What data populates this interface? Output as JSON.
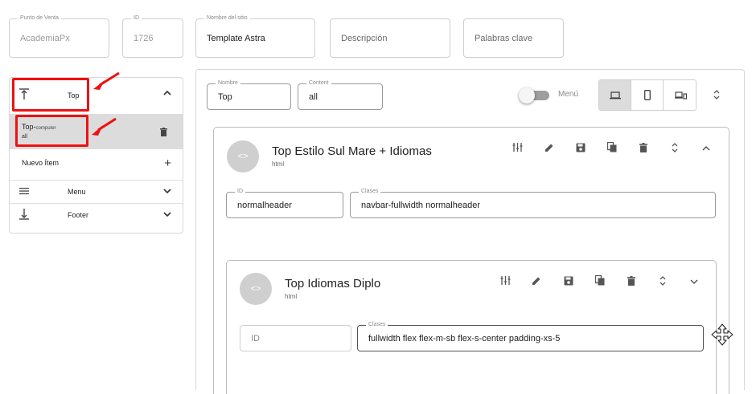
{
  "top_fields": {
    "punto_venta": {
      "label": "Punto de Venta",
      "value": "AcademiaPx"
    },
    "id": {
      "label": "ID",
      "value": "1726"
    },
    "nombre_sitio": {
      "label": "Nombre del sitio",
      "value": "Template Astra"
    },
    "descripcion": {
      "placeholder": "Descripción"
    },
    "palabras_clave": {
      "placeholder": "Palabras clave"
    }
  },
  "sidebar": {
    "top": {
      "label": "Top",
      "icon": "align-top-icon"
    },
    "top_item": {
      "title": "Top-",
      "device": "computer",
      "sub": "all"
    },
    "nuevo_item": {
      "label": "Nuevo Ítem"
    },
    "menu": {
      "label": "Menu",
      "icon": "menu-icon"
    },
    "footer": {
      "label": "Footer",
      "icon": "align-bottom-icon"
    }
  },
  "section": {
    "nombre": {
      "label": "Nombre",
      "value": "Top"
    },
    "content": {
      "label": "Content",
      "value": "all"
    },
    "menu_toggle_label": "Menú",
    "menu_toggle_on": false,
    "devices": [
      "computer",
      "phone",
      "devices"
    ],
    "active_device": "computer"
  },
  "block1": {
    "avatar": "<>",
    "title": "Top Estilo Sul Mare + Idiomas",
    "type": "html",
    "id": {
      "label": "ID",
      "value": "normalheader"
    },
    "clases": {
      "label": "Clases",
      "value": "navbar-fullwidth normalheader"
    }
  },
  "block2": {
    "avatar": "<>",
    "title": "Top Idiomas Diplo",
    "type": "html",
    "id": {
      "placeholder": "ID"
    },
    "clases": {
      "label": "Clases",
      "value": "fullwidth flex flex-m-sb flex-s-center padding-xs-5"
    }
  },
  "colors": {
    "annotation": "#ee1111",
    "active_device_bg": "#dcdcdc"
  }
}
